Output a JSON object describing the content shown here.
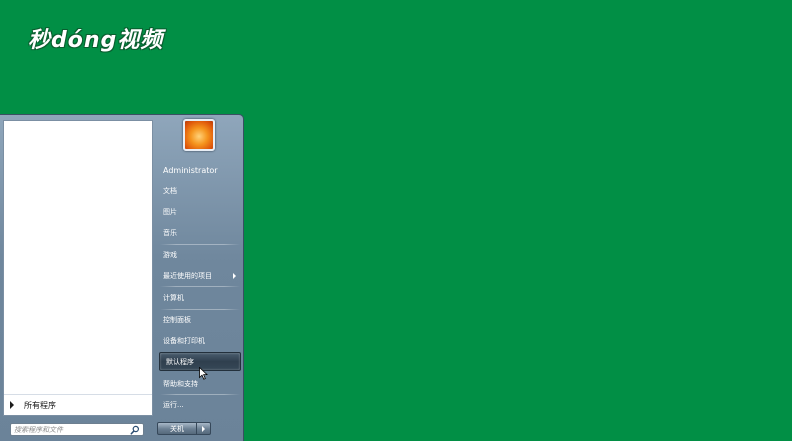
{
  "watermark": {
    "text": "秒dóng视频"
  },
  "start_menu": {
    "left_pane": {
      "all_programs_label": "所有程序"
    },
    "search": {
      "placeholder": "搜索程序和文件"
    },
    "right_pane": {
      "user_name": "Administrator",
      "items": [
        {
          "label": "文档"
        },
        {
          "label": "图片"
        },
        {
          "label": "音乐"
        },
        {
          "label": "游戏"
        },
        {
          "label": "最近使用的项目"
        },
        {
          "label": "计算机"
        },
        {
          "label": "控制面板"
        },
        {
          "label": "设备和打印机"
        },
        {
          "label": "默认程序"
        },
        {
          "label": "帮助和支持"
        },
        {
          "label": "运行..."
        }
      ]
    },
    "shutdown_label": "关机"
  }
}
